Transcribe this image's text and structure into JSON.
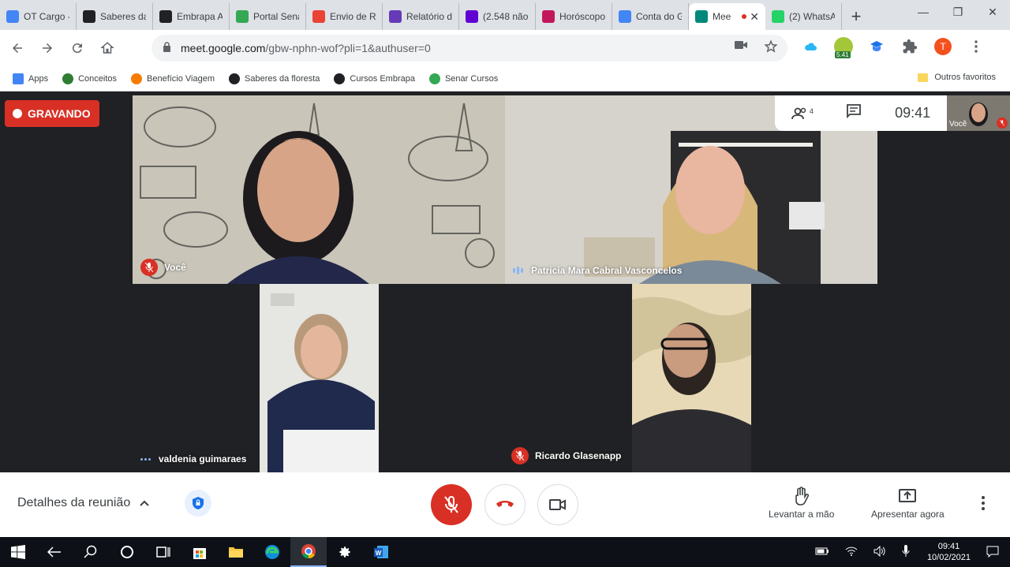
{
  "tabs": [
    {
      "title": "OT Cargo - ",
      "favicon": "document-icon",
      "color": "#4285f4"
    },
    {
      "title": "Saberes da ",
      "favicon": "m-icon",
      "color": "#202124"
    },
    {
      "title": "Embrapa AV",
      "favicon": "m-icon",
      "color": "#202124"
    },
    {
      "title": "Portal Sena",
      "favicon": "senar-icon",
      "color": "#34a853"
    },
    {
      "title": "Envio de Re",
      "favicon": "gmail-icon",
      "color": "#ea4335"
    },
    {
      "title": "Relatório de",
      "favicon": "form-icon",
      "color": "#673ab7"
    },
    {
      "title": "(2.548 não l",
      "favicon": "mail-icon",
      "color": "#6001d2"
    },
    {
      "title": "Horóscopo",
      "favicon": "astro-icon",
      "color": "#c2185b"
    },
    {
      "title": "Conta do G",
      "favicon": "google-icon",
      "color": "#4285f4"
    },
    {
      "title": "Mee",
      "favicon": "meet-icon",
      "color": "#00897b"
    },
    {
      "title": "(2) WhatsAp",
      "favicon": "whatsapp-icon",
      "color": "#25d366"
    }
  ],
  "active_tab_index": 9,
  "window_controls": {
    "minimize": "—",
    "restore": "❐",
    "close": "✕"
  },
  "url": {
    "host": "meet.google.com",
    "path": "/gbw-nphn-wof?pli=1&authuser=0"
  },
  "extension_badge": "5.41",
  "profile_initial": "T",
  "bookmarks": [
    {
      "label": "Apps",
      "icon": "apps-grid-icon",
      "color": "#4285f4"
    },
    {
      "label": "Conceitos",
      "icon": "conceitos-icon",
      "color": "#2e7d32"
    },
    {
      "label": "Benefício Viagem",
      "icon": "beneficio-icon",
      "color": "#f57c00"
    },
    {
      "label": "Saberes da floresta",
      "icon": "m-icon",
      "color": "#202124"
    },
    {
      "label": "Cursos Embrapa",
      "icon": "m-icon",
      "color": "#202124"
    },
    {
      "label": "Senar Cursos",
      "icon": "senar-icon",
      "color": "#34a853"
    }
  ],
  "other_bookmarks": "Outros favoritos",
  "meeting": {
    "recording_label": "GRAVANDO",
    "participants_count": "4",
    "time": "09:41",
    "self_label": "Você",
    "participants": [
      {
        "name": "Você",
        "muted": true
      },
      {
        "name": "Patricia Mara Cabral Vasconcelos",
        "muted": false,
        "speaking": true
      },
      {
        "name": "valdenia guimaraes",
        "muted": false,
        "speaking": true
      },
      {
        "name": "Ricardo Glasenapp",
        "muted": true
      }
    ]
  },
  "bottom": {
    "details_label": "Detalhes da reunião",
    "raise_hand_label": "Levantar a mão",
    "present_label": "Apresentar agora"
  },
  "taskbar": {
    "time": "09:41",
    "date": "10/02/2021"
  }
}
